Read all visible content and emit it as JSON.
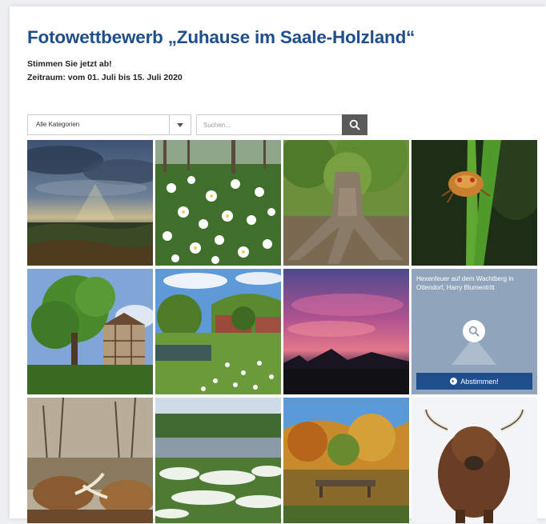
{
  "header": {
    "title": "Fotowettbewerb „Zuhause im Saale-Holzland“",
    "subtitle": "Stimmen Sie jetzt ab!",
    "period": "Zeitraum: vom 01. Juli bis 15. Juli 2020"
  },
  "filters": {
    "category_selected": "Alle Kategorien",
    "search_placeholder": "Suchen..."
  },
  "photos": {
    "hover": {
      "caption": "Hexenfeuer auf dem Wachtberg in Ottendorf, Harry Blumentritt",
      "vote_label": "Abstimmen!"
    }
  },
  "colors": {
    "brand_blue": "#1f4e8c",
    "search_button": "#5a5a5a"
  }
}
